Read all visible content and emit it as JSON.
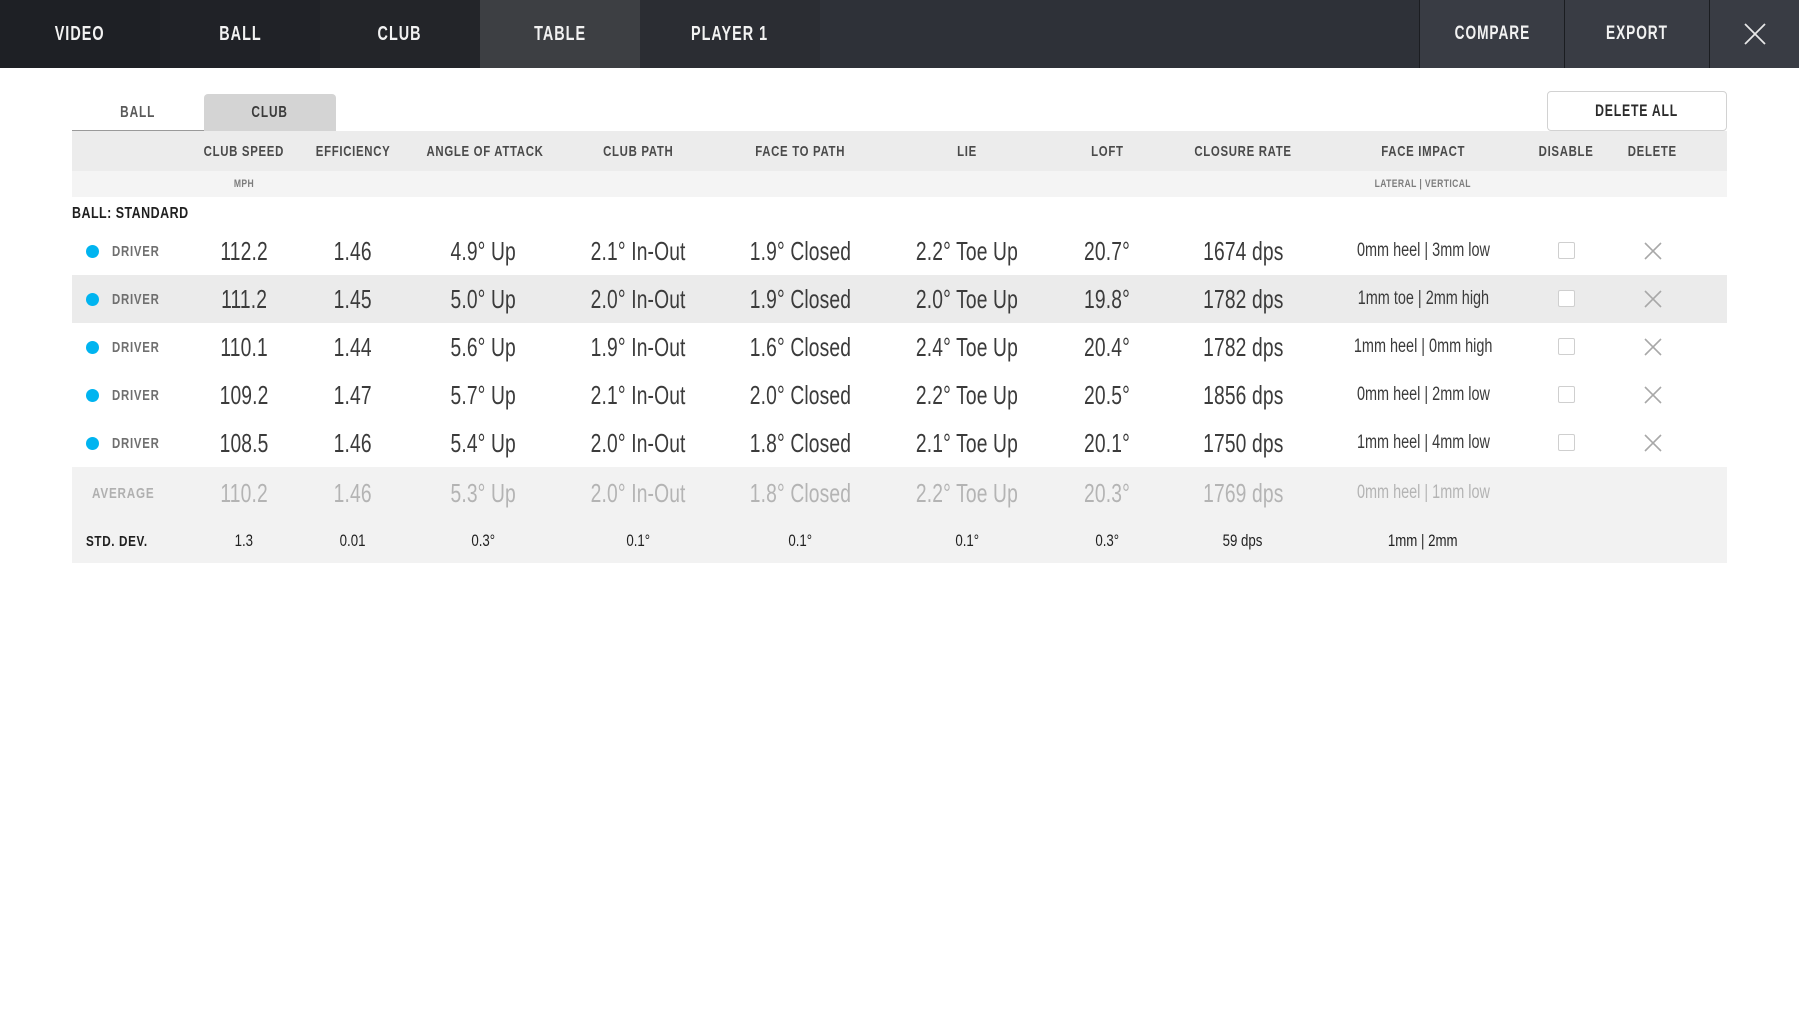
{
  "topnav": {
    "tabs": [
      {
        "label": "VIDEO",
        "key": "video",
        "active": false
      },
      {
        "label": "BALL",
        "key": "ball",
        "active": false
      },
      {
        "label": "CLUB",
        "key": "club",
        "active": false
      },
      {
        "label": "TABLE",
        "key": "table",
        "active": true
      },
      {
        "label": "PLAYER 1",
        "key": "player",
        "active": false
      }
    ],
    "compare_label": "COMPARE",
    "export_label": "EXPORT",
    "close_icon": "close-icon"
  },
  "subtabs": {
    "ball_label": "BALL",
    "club_label": "CLUB",
    "active": "CLUB",
    "delete_all_label": "DELETE ALL"
  },
  "table": {
    "ball_group_label": "BALL: STANDARD",
    "headers": [
      "",
      "CLUB SPEED",
      "EFFICIENCY",
      "ANGLE OF ATTACK",
      "CLUB PATH",
      "FACE TO PATH",
      "LIE",
      "LOFT",
      "CLOSURE RATE",
      "FACE IMPACT",
      "DISABLE",
      "DELETE"
    ],
    "subheaders": [
      "",
      "MPH",
      "",
      "",
      "",
      "",
      "",
      "",
      "",
      "LATERAL | VERTICAL",
      "",
      ""
    ],
    "marker_color": "#00b4f0",
    "rows": [
      {
        "club": "DRIVER",
        "highlight": false,
        "disabled": false,
        "club_speed": "112.2",
        "efficiency": "1.46",
        "angle_of_attack": "4.9° Up",
        "club_path": "2.1° In-Out",
        "face_to_path": "1.9° Closed",
        "lie": "2.2° Toe Up",
        "loft": "20.7°",
        "closure_rate": "1674 dps",
        "face_impact": "0mm heel | 3mm low"
      },
      {
        "club": "DRIVER",
        "highlight": true,
        "disabled": false,
        "club_speed": "111.2",
        "efficiency": "1.45",
        "angle_of_attack": "5.0° Up",
        "club_path": "2.0° In-Out",
        "face_to_path": "1.9° Closed",
        "lie": "2.0° Toe Up",
        "loft": "19.8°",
        "closure_rate": "1782 dps",
        "face_impact": "1mm toe | 2mm high"
      },
      {
        "club": "DRIVER",
        "highlight": false,
        "disabled": false,
        "club_speed": "110.1",
        "efficiency": "1.44",
        "angle_of_attack": "5.6° Up",
        "club_path": "1.9° In-Out",
        "face_to_path": "1.6° Closed",
        "lie": "2.4° Toe Up",
        "loft": "20.4°",
        "closure_rate": "1782 dps",
        "face_impact": "1mm heel | 0mm high"
      },
      {
        "club": "DRIVER",
        "highlight": false,
        "disabled": false,
        "club_speed": "109.2",
        "efficiency": "1.47",
        "angle_of_attack": "5.7° Up",
        "club_path": "2.1° In-Out",
        "face_to_path": "2.0° Closed",
        "lie": "2.2° Toe Up",
        "loft": "20.5°",
        "closure_rate": "1856 dps",
        "face_impact": "0mm heel | 2mm low"
      },
      {
        "club": "DRIVER",
        "highlight": false,
        "disabled": false,
        "club_speed": "108.5",
        "efficiency": "1.46",
        "angle_of_attack": "5.4° Up",
        "club_path": "2.0° In-Out",
        "face_to_path": "1.8° Closed",
        "lie": "2.1° Toe Up",
        "loft": "20.1°",
        "closure_rate": "1750 dps",
        "face_impact": "1mm heel | 4mm low"
      }
    ],
    "average": {
      "label": "AVERAGE",
      "club_speed": "110.2",
      "efficiency": "1.46",
      "angle_of_attack": "5.3° Up",
      "club_path": "2.0° In-Out",
      "face_to_path": "1.8° Closed",
      "lie": "2.2° Toe Up",
      "loft": "20.3°",
      "closure_rate": "1769 dps",
      "face_impact": "0mm heel | 1mm low"
    },
    "std_dev": {
      "label": "STD. DEV.",
      "club_speed": "1.3",
      "efficiency": "0.01",
      "angle_of_attack": "0.3°",
      "club_path": "0.1°",
      "face_to_path": "0.1°",
      "lie": "0.1°",
      "loft": "0.3°",
      "closure_rate": "59 dps",
      "face_impact": "1mm | 2mm"
    }
  }
}
